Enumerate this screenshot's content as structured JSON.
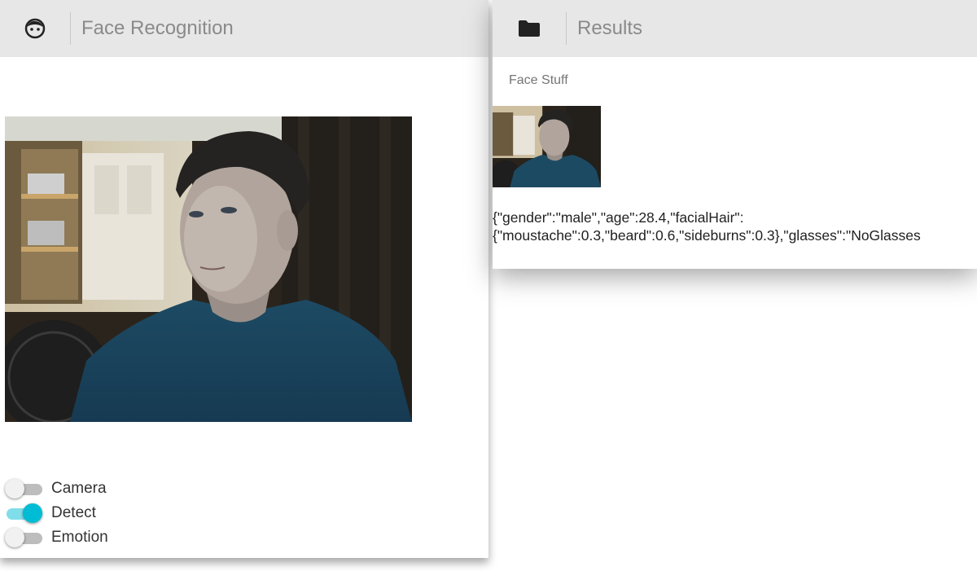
{
  "left_panel": {
    "icon": "face-icon",
    "title": "Face Recognition",
    "toggles": [
      {
        "label": "Camera",
        "on": false
      },
      {
        "label": "Detect",
        "on": true
      },
      {
        "label": "Emotion",
        "on": false
      }
    ]
  },
  "right_panel": {
    "icon": "folder-icon",
    "title": "Results",
    "section_label": "Face Stuff",
    "json_line1": "{\"gender\":\"male\",\"age\":28.4,\"facialHair\":",
    "json_line2": "{\"moustache\":0.3,\"beard\":0.6,\"sideburns\":0.3},\"glasses\":\"NoGlasses"
  },
  "colors": {
    "header_bg": "#e7e7e7",
    "toggle_on": "#00bcd4",
    "toggle_on_track": "#80deea",
    "toggle_off_track": "#bdbdbd"
  }
}
